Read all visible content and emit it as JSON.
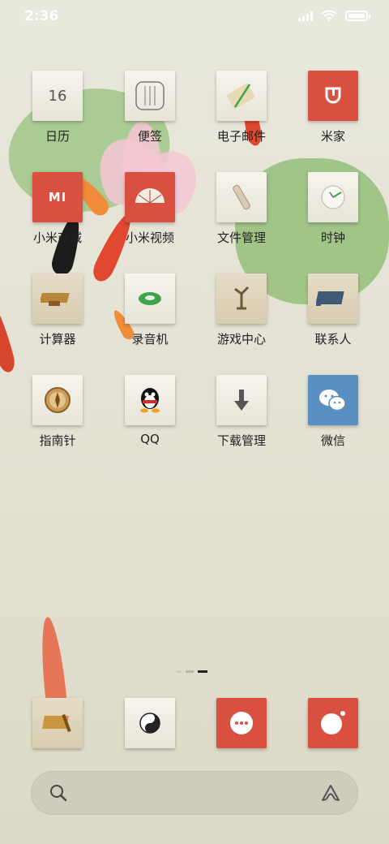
{
  "status_bar": {
    "time": "2:36"
  },
  "apps": [
    {
      "label": "日历",
      "icon": "calendar-icon",
      "day": "16"
    },
    {
      "label": "便签",
      "icon": "notes-icon"
    },
    {
      "label": "电子邮件",
      "icon": "email-icon"
    },
    {
      "label": "米家",
      "icon": "mijia-icon"
    },
    {
      "label": "小米商城",
      "icon": "mi-store-icon",
      "badge_text": "MI"
    },
    {
      "label": "小米视频",
      "icon": "mi-video-icon"
    },
    {
      "label": "文件管理",
      "icon": "file-manager-icon"
    },
    {
      "label": "时钟",
      "icon": "clock-icon"
    },
    {
      "label": "计算器",
      "icon": "calculator-icon"
    },
    {
      "label": "录音机",
      "icon": "recorder-icon"
    },
    {
      "label": "游戏中心",
      "icon": "game-center-icon"
    },
    {
      "label": "联系人",
      "icon": "contacts-icon"
    },
    {
      "label": "指南针",
      "icon": "compass-icon"
    },
    {
      "label": "QQ",
      "icon": "qq-icon"
    },
    {
      "label": "下载管理",
      "icon": "download-manager-icon"
    },
    {
      "label": "微信",
      "icon": "wechat-icon"
    }
  ],
  "dock": [
    {
      "icon": "scroll-icon"
    },
    {
      "icon": "yin-yang-icon"
    },
    {
      "icon": "messages-icon"
    },
    {
      "icon": "camera-icon"
    }
  ],
  "page_indicator": {
    "pages": 3,
    "active": 3
  },
  "colors": {
    "brand_red": "#d94f40",
    "wechat_blue": "#5a8fc2",
    "leaf_green": "#97c27c"
  }
}
